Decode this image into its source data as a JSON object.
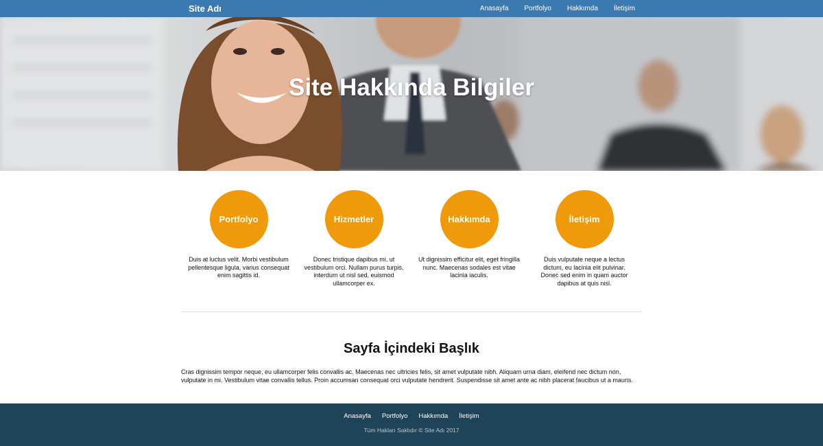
{
  "navbar": {
    "brand": "Site Adı",
    "links": [
      "Anasayfa",
      "Portfolyo",
      "Hakkımda",
      "İletişim"
    ]
  },
  "hero": {
    "title": "Site Hakkında Bilgiler"
  },
  "features": [
    {
      "title": "Portfolyo",
      "text": "Duis at luctus velit. Morbi vestibulum pellentesque ligula, varius consequat enim sagittis id."
    },
    {
      "title": "Hizmetler",
      "text": "Donec tristique dapibus mi, ut vestibulum orci. Nullam purus turpis, interdum ut nisl sed, euismod ullamcorper ex."
    },
    {
      "title": "Hakkımda",
      "text": "Ut dignissim efficitur elit, eget fringilla nunc. Maecenas sodales est vitae lacinia iaculis."
    },
    {
      "title": "İletişim",
      "text": "Duis vulputate neque a lectus dictum, eu lacinia elit pulvinar. Donec sed enim in quam auctor dapibus at quis nisl."
    }
  ],
  "section": {
    "title": "Sayfa İçindeki Başlık",
    "text": "Cras dignissim tempor neque, eu ullamcorper felis convallis ac. Maecenas nec ultricies felis, sit amet vulputate nibh. Aliquam urna diam, eleifend nec dictum non, vulputate in mi. Vestibulum vitae convallis tellus. Proin accumsan consequat orci vulputate hendrerit. Suspendisse sit amet ante ac nibh placerat faucibus ut a mauris."
  },
  "footer": {
    "links": [
      "Anasayfa",
      "Portfolyo",
      "Hakkımda",
      "İletişim"
    ],
    "copyright": "Tüm Hakları Saklıdır © Site Adı 2017"
  },
  "colors": {
    "navbar": "#3a7ab1",
    "accent": "#ef9a0a",
    "footer": "#1f4459"
  }
}
